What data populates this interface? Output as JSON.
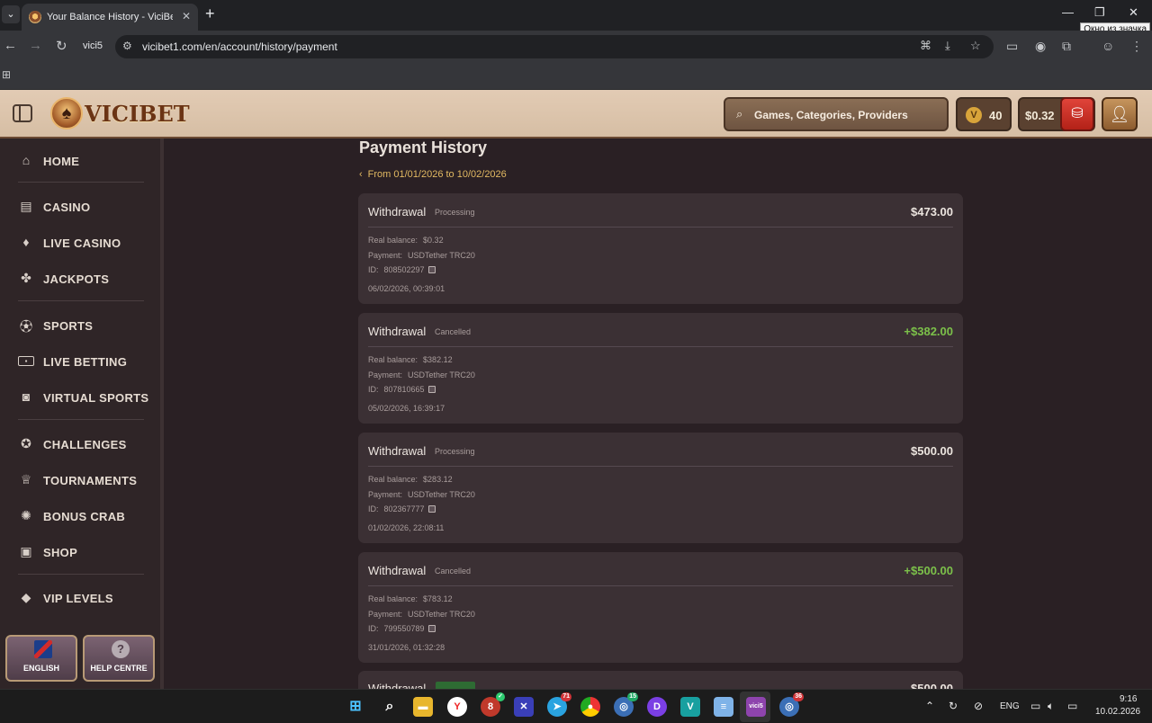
{
  "browser": {
    "tab_title": "Your Balance History - ViciBet Casino",
    "profile_label": "vici5",
    "url": "vicibet1.com/en/account/history/payment",
    "tooltip": "Окно из значка"
  },
  "header": {
    "logo_text": "VICIBET",
    "search_placeholder": "Games, Categories, Providers",
    "vpoints": "40",
    "vpoints_symbol": "V",
    "balance": "$0.32"
  },
  "sidebar": {
    "items": [
      {
        "label": "HOME",
        "icon": "home-icon"
      },
      {
        "label": "CASINO",
        "icon": "slot-machine-icon"
      },
      {
        "label": "LIVE CASINO",
        "icon": "cards-icon"
      },
      {
        "label": "JACKPOTS",
        "icon": "clover-icon"
      },
      {
        "label": "SPORTS",
        "icon": "football-icon"
      },
      {
        "label": "LIVE BETTING",
        "icon": "live-icon"
      },
      {
        "label": "VIRTUAL SPORTS",
        "icon": "virtual-sports-icon"
      },
      {
        "label": "CHALLENGES",
        "icon": "medal-icon"
      },
      {
        "label": "TOURNAMENTS",
        "icon": "trophy-icon"
      },
      {
        "label": "BONUS CRAB",
        "icon": "crab-claw-icon"
      },
      {
        "label": "SHOP",
        "icon": "shopping-bag-icon"
      },
      {
        "label": "VIP LEVELS",
        "icon": "diamond-icon"
      }
    ],
    "language_button": "ENGLISH",
    "help_button": "HELP CENTRE"
  },
  "main": {
    "title": "Payment History",
    "date_range": "From 01/01/2026 to 10/02/2026",
    "labels": {
      "real_balance": "Real balance:",
      "payment": "Payment:",
      "id": "ID:"
    },
    "transactions": [
      {
        "type": "Withdrawal",
        "status": "Processing",
        "amount": "$473.00",
        "positive": false,
        "real_balance": "$0.32",
        "payment": "USDTether TRC20",
        "id": "808502297",
        "date": "06/02/2026, 00:39:01"
      },
      {
        "type": "Withdrawal",
        "status": "Cancelled",
        "amount": "+$382.00",
        "positive": true,
        "real_balance": "$382.12",
        "payment": "USDTether TRC20",
        "id": "807810665",
        "date": "05/02/2026, 16:39:17"
      },
      {
        "type": "Withdrawal",
        "status": "Processing",
        "amount": "$500.00",
        "positive": false,
        "real_balance": "$283.12",
        "payment": "USDTether TRC20",
        "id": "802367777",
        "date": "01/02/2026, 22:08:11"
      },
      {
        "type": "Withdrawal",
        "status": "Cancelled",
        "amount": "+$500.00",
        "positive": true,
        "real_balance": "$783.12",
        "payment": "USDTether TRC20",
        "id": "799550789",
        "date": "31/01/2026, 01:32:28"
      }
    ],
    "partial_card": {
      "type": "Withdrawal",
      "amount": "$500.00"
    }
  },
  "taskbar": {
    "language": "ENG",
    "time": "9:16",
    "date": "10.02.2026",
    "badges": {
      "app8": "",
      "telegram": "71",
      "app15": "15",
      "app36": "36"
    },
    "active_app_label": "vici5"
  }
}
